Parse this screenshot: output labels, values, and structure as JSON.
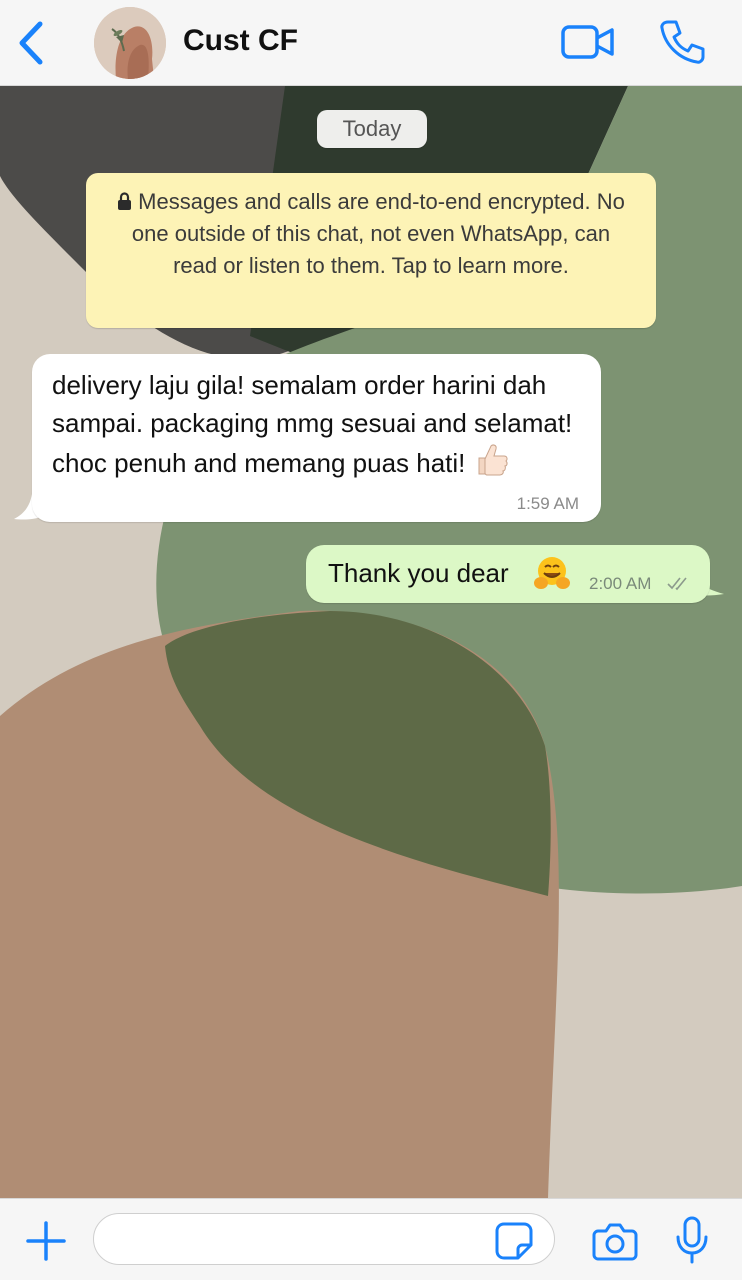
{
  "header": {
    "contact_name": "Cust CF",
    "icons": [
      "chevron-left-icon",
      "video-camera-icon",
      "phone-icon"
    ]
  },
  "chat": {
    "date_label": "Today",
    "encryption_notice": "Messages and calls are end-to-end encrypted. No one outside of this chat, not even WhatsApp, can read or listen to them. Tap to learn more.",
    "messages": [
      {
        "direction": "incoming",
        "text": "delivery laju gila! semalam order harini dah sampai. packaging mmg sesuai and selamat! choc penuh and memang puas hati!",
        "emoji": "thumbs-up",
        "time": "1:59 AM"
      },
      {
        "direction": "outgoing",
        "text": "Thank you dear",
        "emoji": "hugging-face",
        "time": "2:00 AM",
        "status": "read"
      }
    ]
  },
  "input_bar": {
    "placeholder": "",
    "icons": [
      "plus-icon",
      "sticker-icon",
      "camera-icon",
      "microphone-icon"
    ]
  },
  "colors": {
    "accent": "#1a82fb",
    "incoming_bubble": "#ffffff",
    "outgoing_bubble": "#dcf8c6",
    "system_bubble": "#fdf3b6"
  }
}
